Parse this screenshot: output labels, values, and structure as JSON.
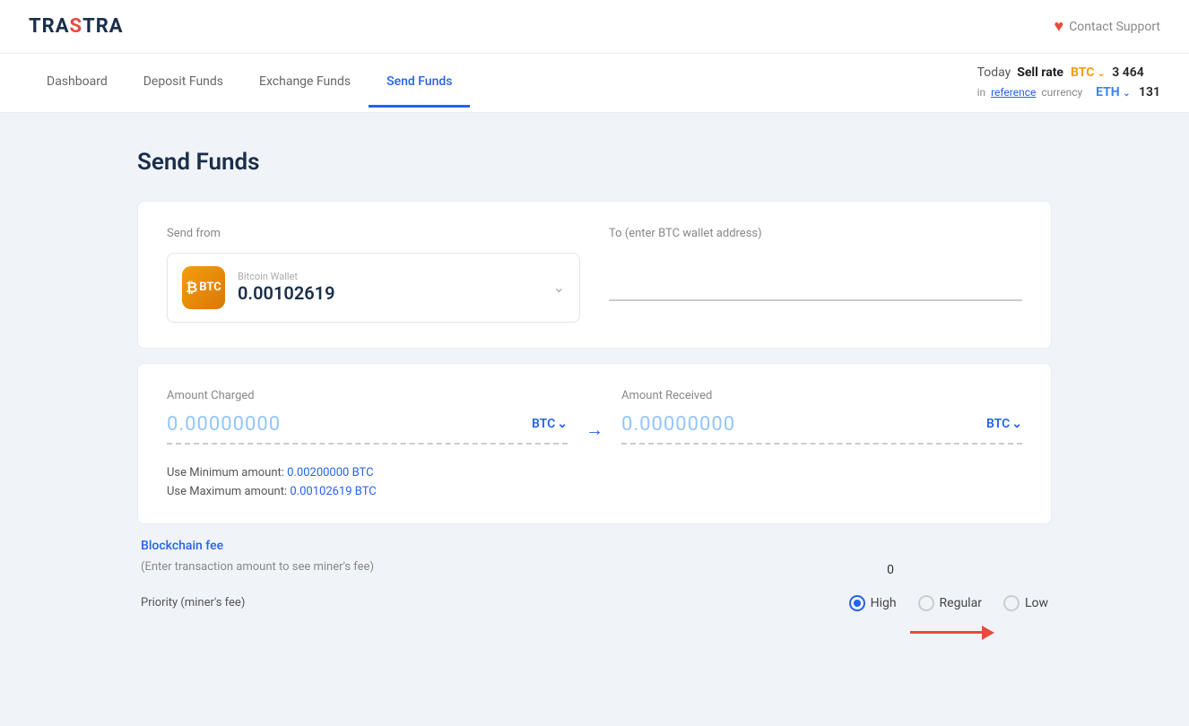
{
  "header": {
    "logo": "TRASTRA",
    "contact_support": "Contact Support"
  },
  "nav": {
    "links": [
      {
        "id": "dashboard",
        "label": "Dashboard",
        "active": false
      },
      {
        "id": "deposit",
        "label": "Deposit Funds",
        "active": false
      },
      {
        "id": "exchange",
        "label": "Exchange Funds",
        "active": false
      },
      {
        "id": "send",
        "label": "Send Funds",
        "active": true
      }
    ],
    "sell_rate": {
      "label": "Today",
      "bold": "Sell rate",
      "btc_label": "BTC",
      "btc_value": "3 464",
      "eth_label": "ETH",
      "eth_value": "131",
      "reference_text": "in",
      "reference_link": "reference",
      "currency_suffix": "currency"
    }
  },
  "page": {
    "title": "Send Funds"
  },
  "send_from": {
    "label": "Send from",
    "wallet_type": "Bitcoin Wallet",
    "wallet_amount": "0.00102619",
    "currency": "BTC"
  },
  "send_to": {
    "label": "To (enter BTC wallet address)",
    "placeholder": ""
  },
  "amount_charged": {
    "label": "Amount Charged",
    "value": "0.00000000",
    "currency": "BTC"
  },
  "amount_received": {
    "label": "Amount Received",
    "value": "0.00000000",
    "currency": "BTC"
  },
  "limits": {
    "min_label": "Use Minimum amount:",
    "min_value": "0.00200000 BTC",
    "max_label": "Use Maximum amount:",
    "max_value": "0.00102619 BTC"
  },
  "blockchain_fee": {
    "title": "Blockchain fee",
    "subtitle": "(Enter transaction amount to see miner's fee)",
    "value": "0"
  },
  "priority": {
    "label": "Priority (miner's fee)",
    "options": [
      {
        "id": "high",
        "label": "High",
        "selected": true
      },
      {
        "id": "regular",
        "label": "Regular",
        "selected": false
      },
      {
        "id": "low",
        "label": "Low",
        "selected": false
      }
    ]
  }
}
